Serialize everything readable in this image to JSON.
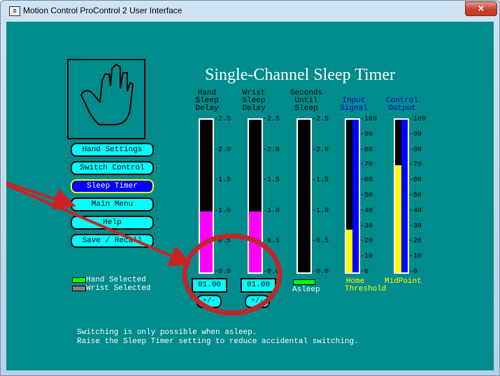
{
  "window": {
    "title": "Motion Control ProControl 2 User Interface",
    "icon_glyph": "≣",
    "close_glyph": "×"
  },
  "page": {
    "title": "Single-Channel Sleep Timer"
  },
  "nav": {
    "hand_settings": "Hand Settings",
    "switch_control": "Switch Control",
    "sleep_timer": "Sleep Timer",
    "main_menu": "Main Menu",
    "help": "Help",
    "save_recall": "Save / Recall"
  },
  "columns": {
    "hand_delay": {
      "label": "Hand\nSleep\nDelay",
      "value": "01.00",
      "button": "+/-",
      "level": 0.4,
      "fill_color": "#ff00ff"
    },
    "wrist_delay": {
      "label": "Wrist\nSleep\nDelay",
      "value": "01.00",
      "button": "+/-",
      "level": 0.4,
      "fill_color": "#ff00ff"
    },
    "seconds_until_sleep": {
      "label": "Seconds\nUntil\nSleep",
      "status": "Asleep",
      "level": 0.0
    },
    "input_signal": {
      "label": "Input\nSignal",
      "bottom_label": "Home\nThreshold",
      "level": 0.28,
      "fill_color": "#ffff00"
    },
    "control_output": {
      "label": "Control\nOutput",
      "bottom_label": "MidPoint",
      "level": 0.7,
      "fill_color": "#ffff00"
    }
  },
  "scale_delay": [
    "2.5",
    "2.0",
    "1.5",
    "1.0",
    "0.5",
    "0.0"
  ],
  "scale_pct": [
    "100",
    "90",
    "80",
    "70",
    "60",
    "50",
    "40",
    "30",
    "20",
    "10",
    "0"
  ],
  "legend": {
    "hand_selected": "Hand Selected",
    "wrist_selected": "Wrist Selected"
  },
  "messages": {
    "line1": "Switching is only possible when asleep.",
    "line2": "Raise the Sleep Timer setting to reduce accidental switching."
  },
  "colors": {
    "background": "#008c8c",
    "accent_button": "#00ffff",
    "active_button": "#0000ff",
    "annotation": "#cc2222",
    "header_blue": "#0000c8",
    "status_green": "#00ff00"
  }
}
